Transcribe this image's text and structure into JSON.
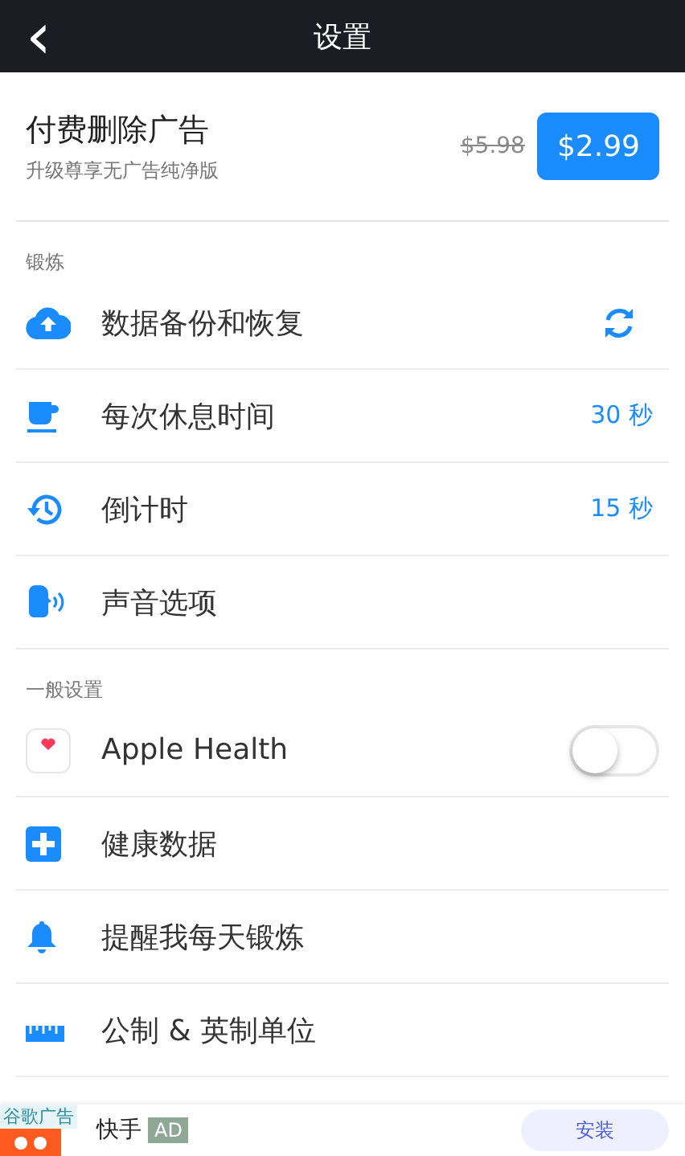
{
  "nav": {
    "back": "‹",
    "title": "设置"
  },
  "promo": {
    "title": "付费删除广告",
    "subtitle": "升级尊享无广告纯净版",
    "old_price": "$5.98",
    "price": "$2.99"
  },
  "sections": [
    {
      "label": "锻炼",
      "items": [
        {
          "kind": "sync",
          "label": "数据备份和恢复"
        },
        {
          "kind": "value",
          "label": "每次休息时间",
          "value": "30 秒"
        },
        {
          "kind": "value",
          "label": "倒计时",
          "value": "15 秒"
        },
        {
          "kind": "plain",
          "label": "声音选项"
        }
      ]
    },
    {
      "label": "一般设置",
      "items": [
        {
          "kind": "toggle",
          "label": "Apple Health",
          "on": false
        },
        {
          "kind": "plain",
          "label": "健康数据"
        },
        {
          "kind": "plain",
          "label": "提醒我每天锻炼"
        },
        {
          "kind": "plain",
          "label": "公制 & 英制单位"
        }
      ]
    }
  ],
  "ad": {
    "tag": "谷歌广告",
    "name": "快手",
    "badge": "AD",
    "button": "安装"
  }
}
